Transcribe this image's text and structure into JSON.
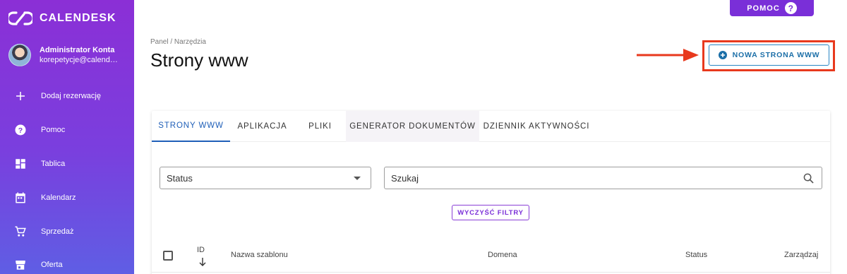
{
  "brand": {
    "name": "CALENDESK"
  },
  "profile": {
    "name": "Administrator Konta",
    "email": "korepetycje@calendesk.net"
  },
  "sidebar": {
    "items": [
      {
        "label": "Dodaj rezerwację",
        "icon": "plus-icon"
      },
      {
        "label": "Pomoc",
        "icon": "help-circle-icon"
      },
      {
        "label": "Tablica",
        "icon": "dashboard-icon"
      },
      {
        "label": "Kalendarz",
        "icon": "calendar-icon"
      },
      {
        "label": "Sprzedaż",
        "icon": "cart-icon"
      },
      {
        "label": "Oferta",
        "icon": "store-icon"
      }
    ]
  },
  "topbar": {
    "help_label": "POMOC",
    "help_icon_glyph": "?"
  },
  "header": {
    "breadcrumb": "Panel / Narzędzia",
    "title": "Strony www",
    "new_button_label": "NOWA STRONA WWW"
  },
  "tabs": [
    {
      "label": "STRONY WWW",
      "active": true
    },
    {
      "label": "APLIKACJA",
      "active": false
    },
    {
      "label": "PLIKI",
      "active": false
    },
    {
      "label": "GENERATOR DOKUMENTÓW",
      "active": false
    },
    {
      "label": "DZIENNIK AKTYWNOŚCI",
      "active": false
    }
  ],
  "filters": {
    "status_label": "Status",
    "search_placeholder": "Szukaj",
    "clear_label": "WYCZYŚĆ FILTRY"
  },
  "table": {
    "columns": [
      "ID",
      "Nazwa szablonu",
      "Domena",
      "Status",
      "Zarządzaj"
    ]
  },
  "colors": {
    "sidebar_top": "#8b2fd6",
    "sidebar_bottom": "#5f5ee4",
    "accent_purple": "#7a2fd8",
    "primary_blue": "#1f5fb8",
    "highlight_red": "#e8391d"
  }
}
